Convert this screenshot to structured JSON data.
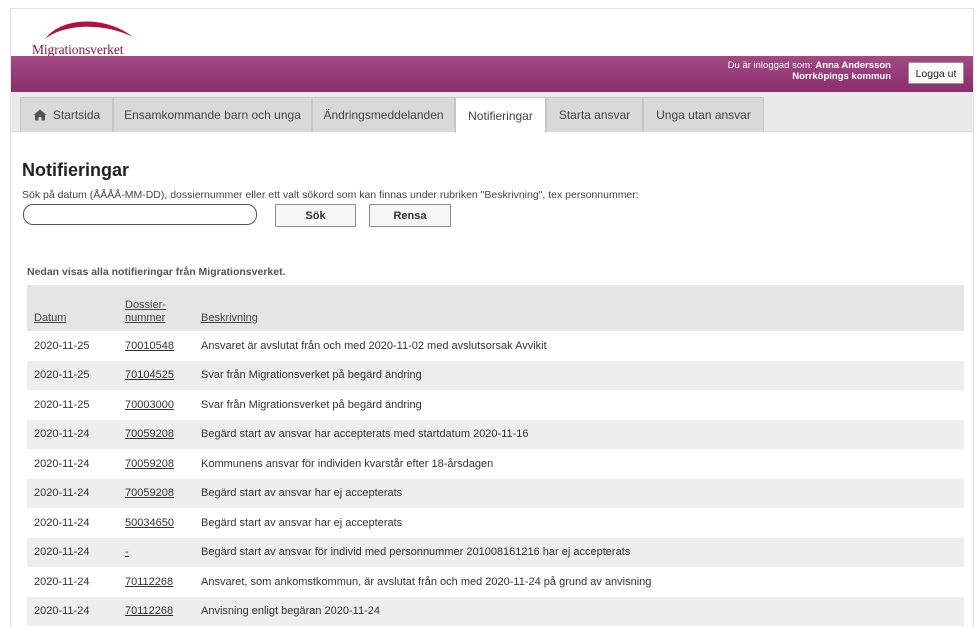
{
  "brand": {
    "name": "Migrationsverket",
    "color": "#8a1538",
    "bar_color": "#98417a"
  },
  "header": {
    "login_prefix": "Du är inloggad som:",
    "user_name": "Anna Andersson",
    "municipality": "Norrköpings kommun",
    "logout_label": "Logga ut"
  },
  "tabs": [
    {
      "label": "Startsida",
      "icon": "home-icon"
    },
    {
      "label": "Ensamkommande barn och unga"
    },
    {
      "label": "Ändringsmeddelanden"
    },
    {
      "label": "Notifieringar",
      "active": true
    },
    {
      "label": "Starta ansvar"
    },
    {
      "label": "Unga utan ansvar"
    }
  ],
  "page": {
    "title": "Notifieringar",
    "search_help": "Sök på datum (ÅÅÅÅ-MM-DD), dossiernummer eller ett valt sökord som kan finnas under rubriken \"Beskrivning\", tex personnummer:",
    "search_value": "",
    "search_button": "Sök",
    "clear_button": "Rensa",
    "intro": "Nedan visas alla notifieringar från Migrationsverket."
  },
  "table": {
    "columns": {
      "date": "Datum",
      "dossier_line1": "Dossier-",
      "dossier_line2": "nummer",
      "description": "Beskrivning"
    },
    "rows": [
      {
        "date": "2020-11-25",
        "dossier": "70010548",
        "description": "Ansvaret är avslutat från och med 2020-11-02 med avslutsorsak Avvikit"
      },
      {
        "date": "2020-11-25",
        "dossier": "70104525",
        "description": "Svar från Migrationsverket på begärd ändring"
      },
      {
        "date": "2020-11-25",
        "dossier": "70003000",
        "description": "Svar från Migrationsverket på begärd ändring"
      },
      {
        "date": "2020-11-24",
        "dossier": "70059208",
        "description": "Begärd start av ansvar har accepterats med startdatum 2020-11-16"
      },
      {
        "date": "2020-11-24",
        "dossier": "70059208",
        "description": "Kommunens ansvar för individen kvarstår efter 18-årsdagen"
      },
      {
        "date": "2020-11-24",
        "dossier": "70059208",
        "description": "Begärd start av ansvar har ej accepterats"
      },
      {
        "date": "2020-11-24",
        "dossier": "50034650",
        "description": "Begärd start av ansvar har ej accepterats"
      },
      {
        "date": "2020-11-24",
        "dossier": "-",
        "description": "Begärd start av ansvar för individ med personnummer 201008161216 har ej accepterats"
      },
      {
        "date": "2020-11-24",
        "dossier": "70112268",
        "description": "Ansvaret, som ankomstkommun, är avslutat från och med 2020-11-24 på grund av anvisning"
      },
      {
        "date": "2020-11-24",
        "dossier": "70112268",
        "description": "Anvisning enligt begäran 2020-11-24"
      }
    ]
  }
}
